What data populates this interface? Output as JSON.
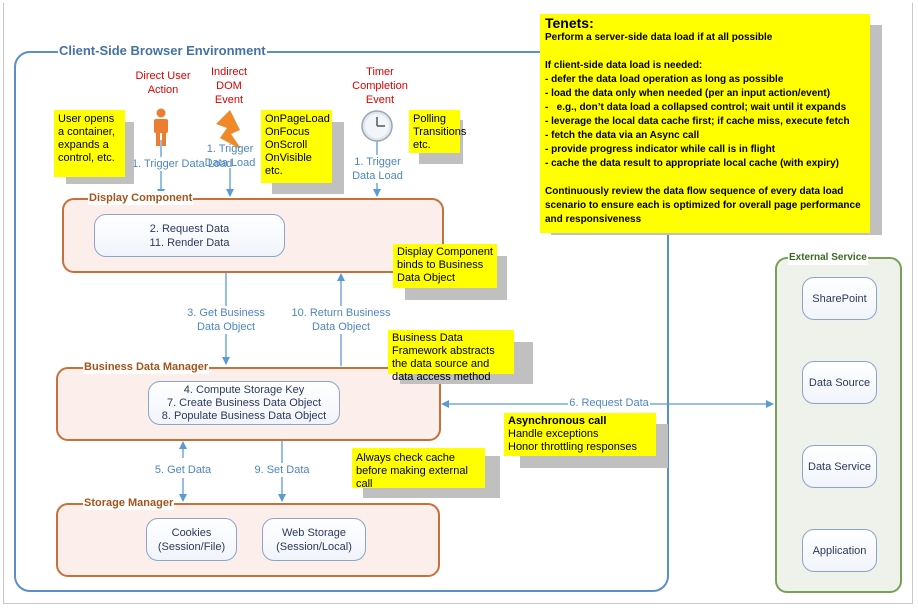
{
  "client_env": {
    "title": "Client-Side Browser Environment"
  },
  "triggers": {
    "direct_user": {
      "label": "Direct User Action",
      "trigger": "1. Trigger Data Load",
      "icon": "person-icon"
    },
    "dom_event": {
      "label": "Indirect DOM Event",
      "trigger": "1. Trigger Data Load",
      "icon": "lightning-icon"
    },
    "timer": {
      "label": "Timer Completion Event",
      "trigger": "1. Trigger Data Load",
      "icon": "clock-icon"
    }
  },
  "notes": {
    "user_opens": "User opens a container, expands a control, etc.",
    "dom_events": [
      "OnPageLoad",
      "OnFocus",
      "OnScroll",
      "OnVisible",
      "etc."
    ],
    "polling": [
      "Polling",
      "Transitions",
      "etc."
    ],
    "binds": "Display Component binds to Business Data Object",
    "framework": "Business Data Framework abstracts the data source and data access method",
    "cache_check": "Always check cache before making external call",
    "async": {
      "title": "Asynchronous call",
      "lines": [
        "Handle exceptions",
        "Honor throttling responses"
      ]
    }
  },
  "tenets": {
    "title": "Tenets:",
    "lines": [
      "Perform a server-side data load if at all possible",
      "",
      "If client-side data load is needed:",
      "- defer the data load operation as long as possible",
      "- load the data only when needed (per an input action/event)",
      "-   e.g., don’t data load a collapsed control; wait until it expands",
      "- leverage the local data cache first; if cache miss, execute fetch",
      "- fetch the data via an Async call",
      "- provide progress indicator while call is in flight",
      "- cache the data result to appropriate local cache (with expiry)",
      "",
      "Continuously review the data flow sequence of every data load",
      "scenario to ensure each is optimized for overall page performance",
      "and responsiveness"
    ]
  },
  "display_component": {
    "title": "Display Component",
    "steps": [
      "2. Request Data",
      "11. Render Data"
    ]
  },
  "business_data_manager": {
    "title": "Business Data Manager",
    "steps": [
      "4. Compute Storage Key",
      "7. Create Business Data Object",
      "8. Populate Business Data Object"
    ]
  },
  "storage_manager": {
    "title": "Storage Manager",
    "stores": [
      {
        "name": "Cookies",
        "sub": "(Session/File)"
      },
      {
        "name": "Web Storage",
        "sub": "(Session/Local)"
      }
    ]
  },
  "flows": {
    "get_bdo": [
      "3. Get Business",
      "Data Object"
    ],
    "return_bdo": [
      "10. Return Business",
      "Data Object"
    ],
    "request_data": "6. Request Data",
    "get_data": "5. Get Data",
    "set_data": "9. Set Data"
  },
  "external_service": {
    "title": "External Service",
    "items": [
      "SharePoint",
      "Data Source",
      "Data Service",
      "Application"
    ]
  },
  "colors": {
    "note": "#ffff00",
    "arrow": "#5b9bd5",
    "client_border": "#5b8fc7",
    "component_border": "#c7703a",
    "external_border": "#77a05a",
    "trigger_text": "#e00000"
  }
}
